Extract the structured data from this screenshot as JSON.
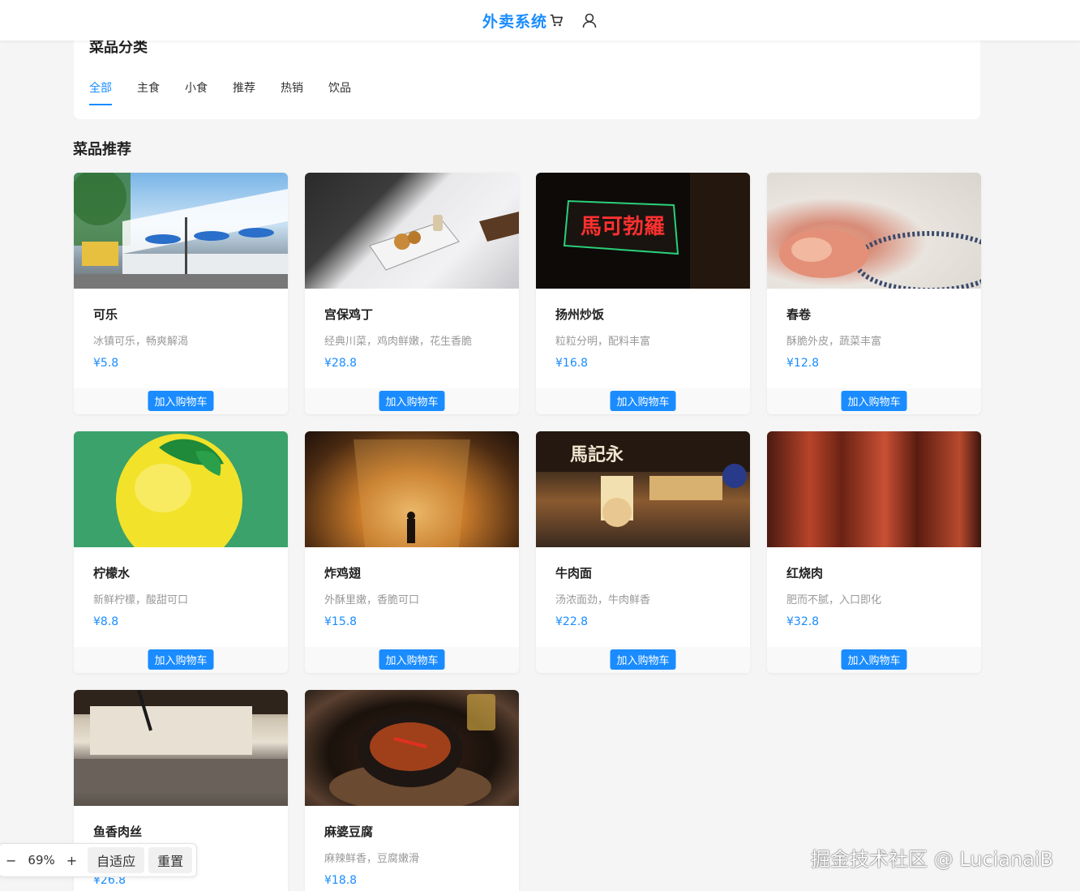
{
  "header": {
    "title": "外卖系统",
    "icons": [
      "cart-icon",
      "user-icon"
    ],
    "accent": "#1a8cff"
  },
  "categories": {
    "title": "菜品分类",
    "tabs": [
      "全部",
      "主食",
      "小食",
      "推荐",
      "热销",
      "饮品"
    ],
    "active": "全部"
  },
  "recommend": {
    "title": "菜品推荐",
    "add_label": "加入购物车",
    "items": [
      {
        "name": "可乐",
        "desc": "冰镇可乐，畅爽解渴",
        "price": "¥5.8"
      },
      {
        "name": "宫保鸡丁",
        "desc": "经典川菜，鸡肉鲜嫩，花生香脆",
        "price": "¥28.8"
      },
      {
        "name": "扬州炒饭",
        "desc": "粒粒分明，配料丰富",
        "price": "¥16.8"
      },
      {
        "name": "春卷",
        "desc": "酥脆外皮，蔬菜丰富",
        "price": "¥12.8"
      },
      {
        "name": "柠檬水",
        "desc": "新鲜柠檬，酸甜可口",
        "price": "¥8.8"
      },
      {
        "name": "炸鸡翅",
        "desc": "外酥里嫩，香脆可口",
        "price": "¥15.8"
      },
      {
        "name": "牛肉面",
        "desc": "汤浓面劲，牛肉鲜香",
        "price": "¥22.8"
      },
      {
        "name": "红烧肉",
        "desc": "肥而不腻，入口即化",
        "price": "¥32.8"
      },
      {
        "name": "鱼香肉丝",
        "desc": "",
        "price": "¥26.8"
      },
      {
        "name": "麻婆豆腐",
        "desc": "麻辣鲜香，豆腐嫩滑",
        "price": "¥18.8"
      }
    ],
    "image_text": {
      "yangzhou_sign": "馬可勃羅",
      "beef_sign": "馬記永"
    }
  },
  "zoom": {
    "minus": "−",
    "value": "69%",
    "plus": "+",
    "fit_label": "自适应",
    "reset_label": "重置"
  },
  "watermark": "掘金技术社区 @ LucianaiB"
}
